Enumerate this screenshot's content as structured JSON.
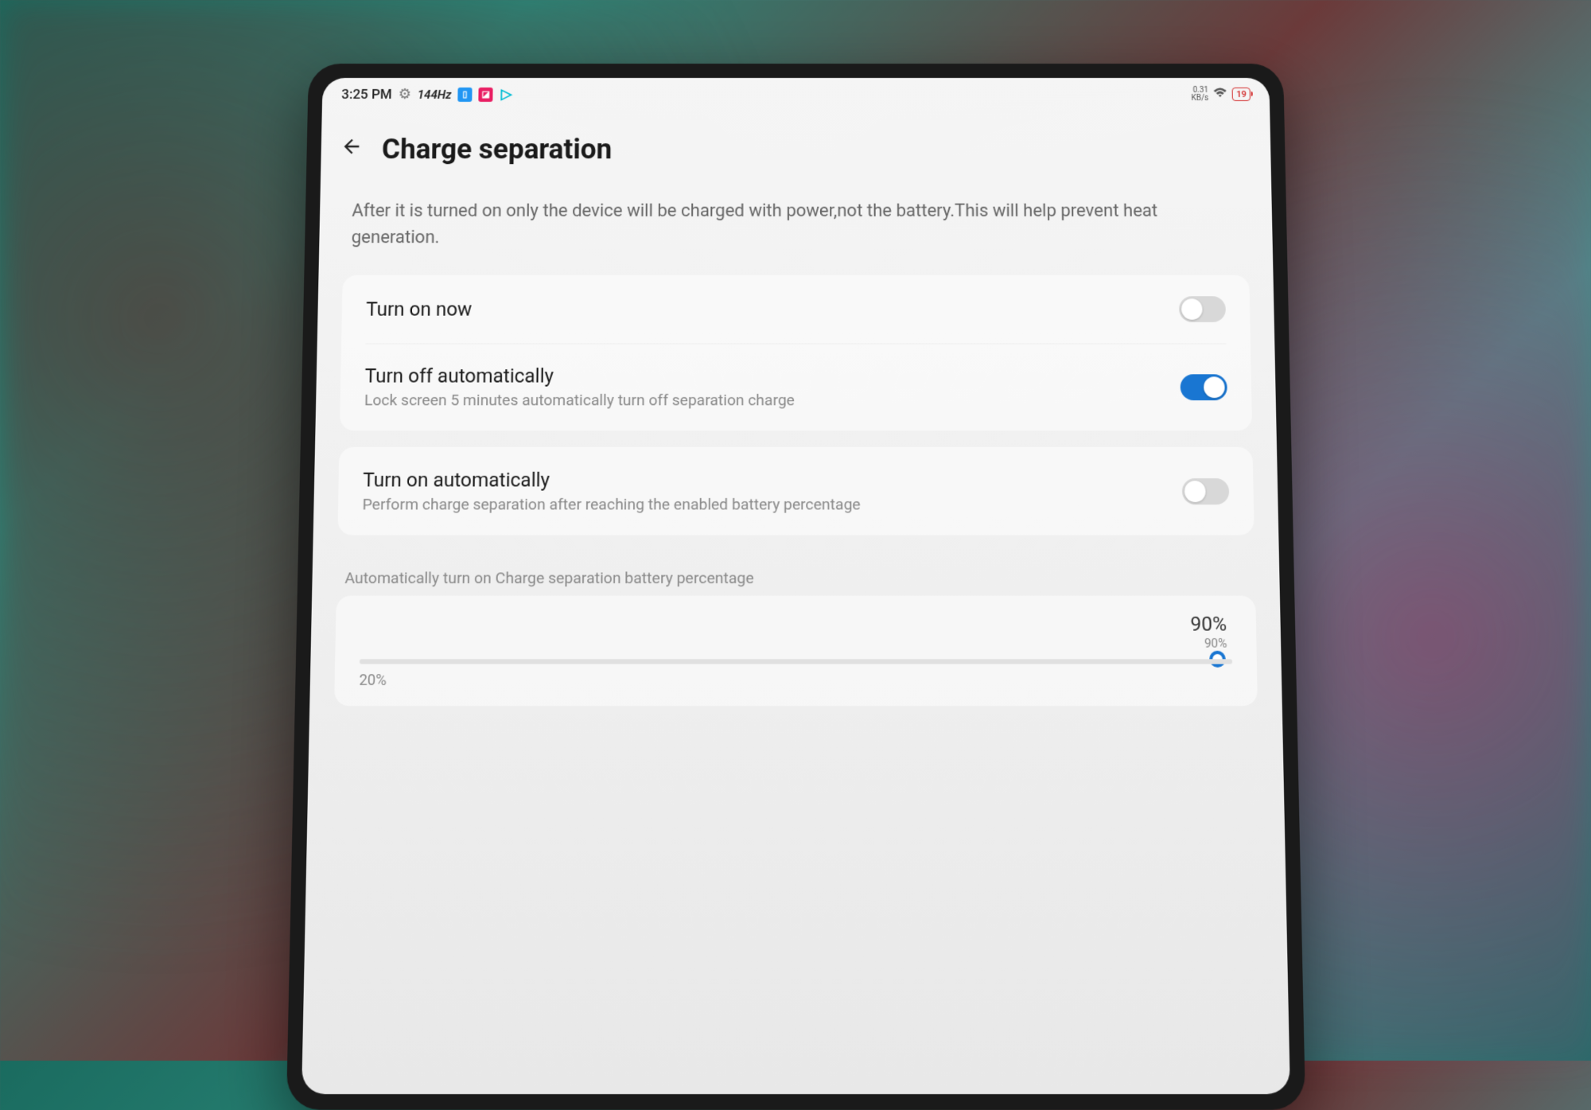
{
  "status_bar": {
    "time": "3:25 PM",
    "refresh_rate": "144Hz",
    "net_speed_value": "0.31",
    "net_speed_unit": "KB/s",
    "battery_percent": "19"
  },
  "header": {
    "title": "Charge separation"
  },
  "description": "After it is turned on only the device will be charged with power,not the battery.This will help prevent heat generation.",
  "settings": {
    "turn_on_now": {
      "label": "Turn on now",
      "enabled": false
    },
    "turn_off_auto": {
      "label": "Turn off automatically",
      "subtitle": "Lock screen 5 minutes automatically turn off separation charge",
      "enabled": true
    },
    "turn_on_auto": {
      "label": "Turn on automatically",
      "subtitle": "Perform charge separation after reaching the enabled battery percentage",
      "enabled": false
    }
  },
  "slider": {
    "section_label": "Automatically turn on Charge separation battery percentage",
    "current_value": "90%",
    "current_value_small": "90%",
    "min_label": "20%"
  }
}
